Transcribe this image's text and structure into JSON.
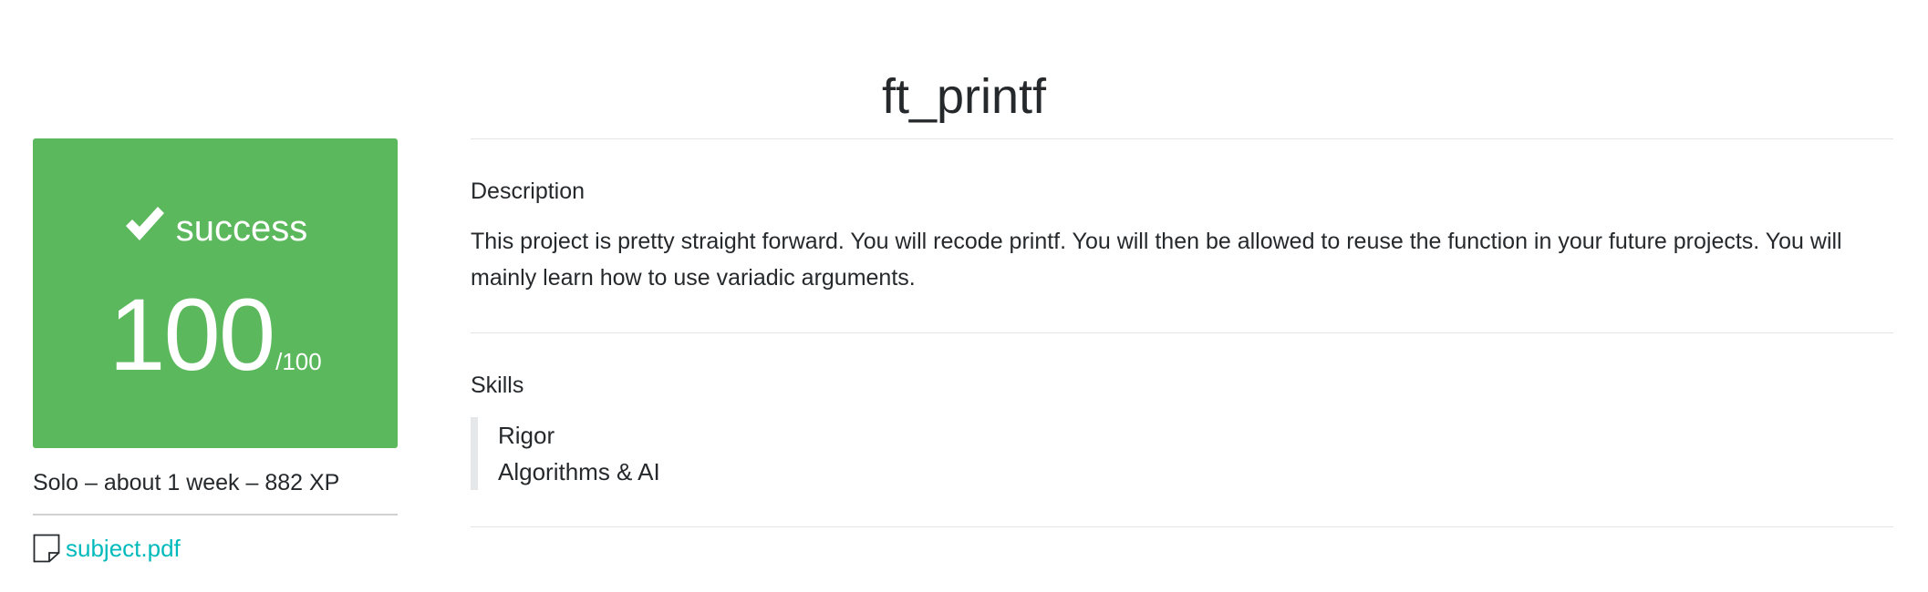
{
  "project": {
    "title": "ft_printf"
  },
  "score_card": {
    "status": "success",
    "score": "100",
    "max": "/100",
    "color": "#5cb85c",
    "icon": "check-icon"
  },
  "meta": {
    "line": "Solo – about 1 week – 882 XP"
  },
  "subject": {
    "label": "subject.pdf",
    "icon": "file-icon",
    "color": "#00babc"
  },
  "description": {
    "title": "Description",
    "text": "This project is pretty straight forward. You will recode printf. You will then be allowed to reuse the function in your future projects. You will mainly learn how to use variadic arguments."
  },
  "skills": {
    "title": "Skills",
    "items": [
      {
        "label": "Rigor"
      },
      {
        "label": "Algorithms & AI"
      }
    ]
  }
}
